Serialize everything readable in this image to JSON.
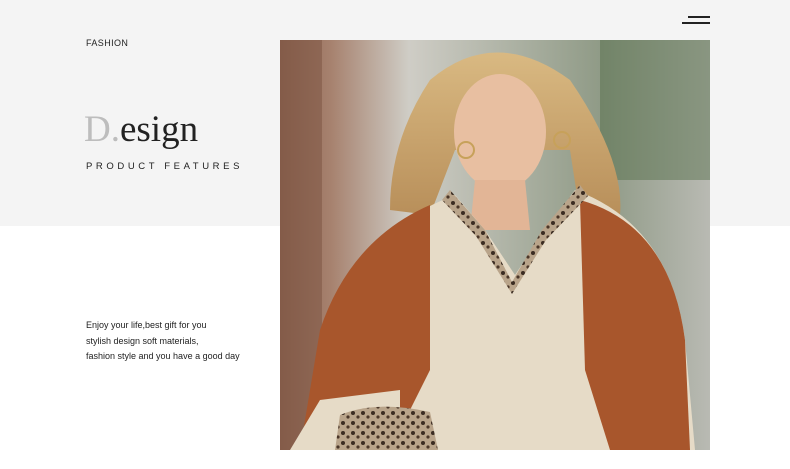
{
  "header": {
    "menu_icon": "menu-icon"
  },
  "intro": {
    "category": "FASHION",
    "title_initial": "D.",
    "title_rest": "esign",
    "subtitle": "PRODUCT FEATURES"
  },
  "description": {
    "lines": [
      "Enjoy your life,best gift for you",
      "stylish design soft materials,",
      "fashion style and you have a good day"
    ]
  },
  "product_photo": {
    "subject": "model wearing cream top with rust sleeves and leopard trim"
  },
  "colors": {
    "band": "#f4f4f4",
    "title_initial": "#bdbdbd",
    "text": "#222222",
    "top_cream": "#e8dcc8",
    "sleeve_rust": "#a8562c"
  }
}
